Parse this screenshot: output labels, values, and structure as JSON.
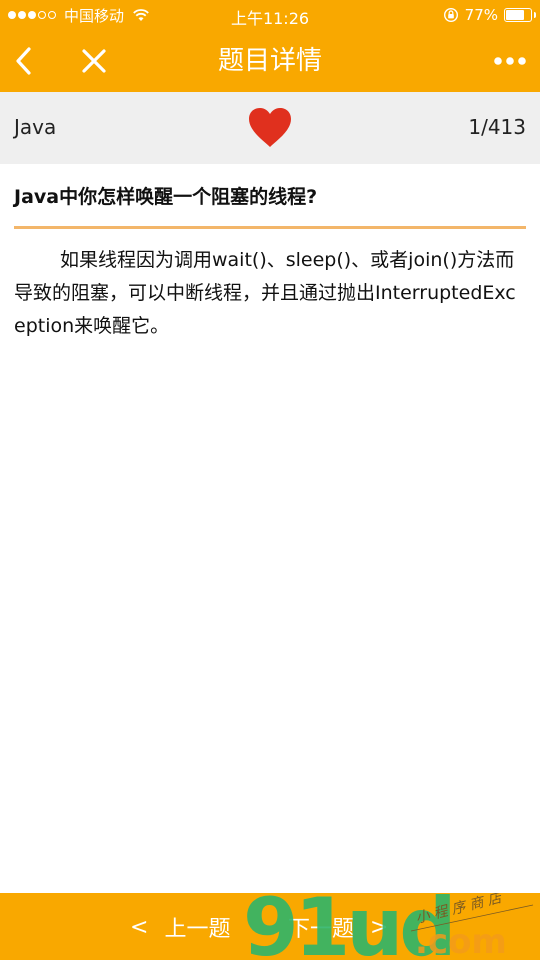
{
  "status_bar": {
    "carrier": "中国移动",
    "time": "上午11:26",
    "battery_percent": "77%",
    "battery_level": 0.77,
    "signal_bars_full": 3,
    "signal_bars_total": 5
  },
  "nav": {
    "title": "题目详情",
    "back_icon": "chevron-left-icon",
    "close_icon": "close-icon",
    "more_icon": "more-dots-icon"
  },
  "info": {
    "category": "Java",
    "counter": "1/413",
    "favorite_icon": "heart-icon",
    "favorite_color": "#e0301e"
  },
  "question": {
    "title": "Java中你怎样唤醒一个阻塞的线程?",
    "answer": "如果线程因为调用wait()、sleep()、或者join()方法而导致的阻塞，可以中断线程，并且通过抛出InterruptedException来唤醒它。"
  },
  "footer": {
    "prev_arrow": "<",
    "prev_label": "上一题",
    "next_label": "下一题",
    "next_arrow": ">"
  },
  "watermark": {
    "brand": "91ud",
    "domain": ".com",
    "tagline": "小程序商店"
  },
  "colors": {
    "accent": "#f9a800",
    "divider": "#f3b66a",
    "info_bg": "#efefef",
    "watermark_green": "#2fb56a",
    "watermark_orange": "#f29b1d"
  }
}
